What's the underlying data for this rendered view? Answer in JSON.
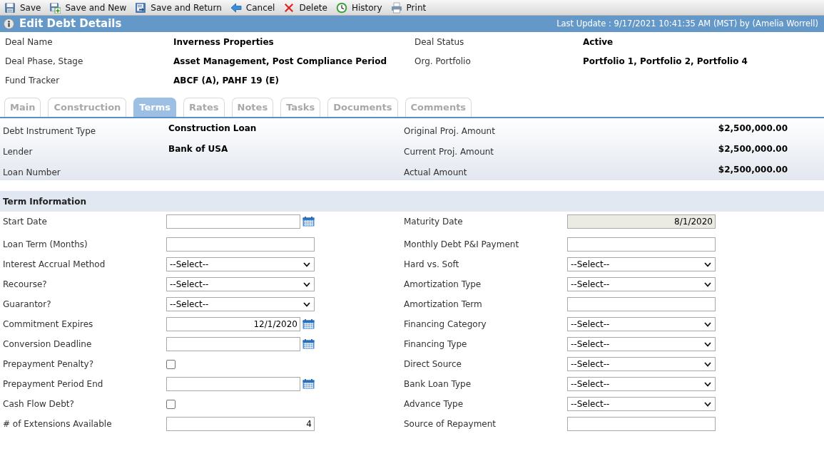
{
  "toolbar": [
    {
      "kind": "save",
      "label": "Save"
    },
    {
      "kind": "save_new",
      "label": "Save and New"
    },
    {
      "kind": "save_return",
      "label": "Save and Return"
    },
    {
      "kind": "cancel",
      "label": "Cancel"
    },
    {
      "kind": "delete",
      "label": "Delete"
    },
    {
      "kind": "history",
      "label": "History"
    },
    {
      "kind": "print",
      "label": "Print"
    }
  ],
  "header": {
    "title": "Edit Debt Details",
    "last_update": "Last Update : 9/17/2021 10:41:35 AM (MST) by (Amelia Worrell)"
  },
  "deal_info": [
    {
      "label": "Deal Name",
      "value": "Inverness Properties"
    },
    {
      "label": "Deal Status",
      "value": "Active"
    },
    {
      "label": "Deal Phase, Stage",
      "value": "Asset Management, Post Compliance Period"
    },
    {
      "label": "Org. Portfolio",
      "value": "Portfolio 1, Portfolio 2, Portfolio 4"
    },
    {
      "label": "Fund Tracker",
      "value": "ABCF (A), PAHF 19 (E)"
    }
  ],
  "tabs": [
    {
      "label": "Main",
      "selected": false
    },
    {
      "label": "Construction",
      "selected": false
    },
    {
      "label": "Terms",
      "selected": true
    },
    {
      "label": "Rates",
      "selected": false
    },
    {
      "label": "Notes",
      "selected": false
    },
    {
      "label": "Tasks",
      "selected": false
    },
    {
      "label": "Documents",
      "selected": false
    },
    {
      "label": "Comments",
      "selected": false
    }
  ],
  "summary": [
    {
      "label": "Debt Instrument Type",
      "value": "Construction Loan"
    },
    {
      "label": "Original Proj. Amount",
      "value": "$2,500,000.00"
    },
    {
      "label": "Lender",
      "value": "Bank of USA"
    },
    {
      "label": "Current Proj. Amount",
      "value": "$2,500,000.00"
    },
    {
      "label": "Loan Number"
    },
    {
      "label": "Actual Amount",
      "value": "$2,500,000.00"
    }
  ],
  "term_information": {
    "title": "Term Information",
    "fields": [
      {
        "label": "Start Date",
        "kind": "date"
      },
      {
        "label": "Maturity Date",
        "kind": "readonly",
        "value": "8/1/2020"
      },
      {
        "label": "Loan Term (Months)",
        "kind": "text"
      },
      {
        "label": "Monthly Debt P&I Payment",
        "kind": "text"
      },
      {
        "label": "Interest Accrual Method",
        "kind": "select",
        "value": "--Select--"
      },
      {
        "label": "Hard vs. Soft",
        "kind": "select",
        "value": "--Select--"
      },
      {
        "label": "Recourse?",
        "kind": "select",
        "value": "--Select--"
      },
      {
        "label": "Amortization Type",
        "kind": "select",
        "value": "--Select--"
      },
      {
        "label": "Guarantor?",
        "kind": "select",
        "value": "--Select--"
      },
      {
        "label": "Amortization Term",
        "kind": "text"
      },
      {
        "label": "Commitment Expires",
        "kind": "date",
        "value": "12/1/2020"
      },
      {
        "label": "Financing Category",
        "kind": "select",
        "value": "--Select--"
      },
      {
        "label": "Conversion Deadline",
        "kind": "date"
      },
      {
        "label": "Financing Type",
        "kind": "select",
        "value": "--Select--"
      },
      {
        "label": "Prepayment Penalty?",
        "kind": "checkbox",
        "checked": false
      },
      {
        "label": "Direct Source",
        "kind": "select",
        "value": "--Select--"
      },
      {
        "label": "Prepayment Period End",
        "kind": "date"
      },
      {
        "label": "Bank Loan Type",
        "kind": "select",
        "value": "--Select--"
      },
      {
        "label": "Cash Flow Debt?",
        "kind": "checkbox",
        "checked": false
      },
      {
        "label": "Advance Type",
        "kind": "select",
        "value": "--Select--"
      },
      {
        "label": "# of Extensions Available",
        "kind": "text",
        "value": "4"
      },
      {
        "label": "Source of Repayment",
        "kind": "text"
      }
    ]
  }
}
